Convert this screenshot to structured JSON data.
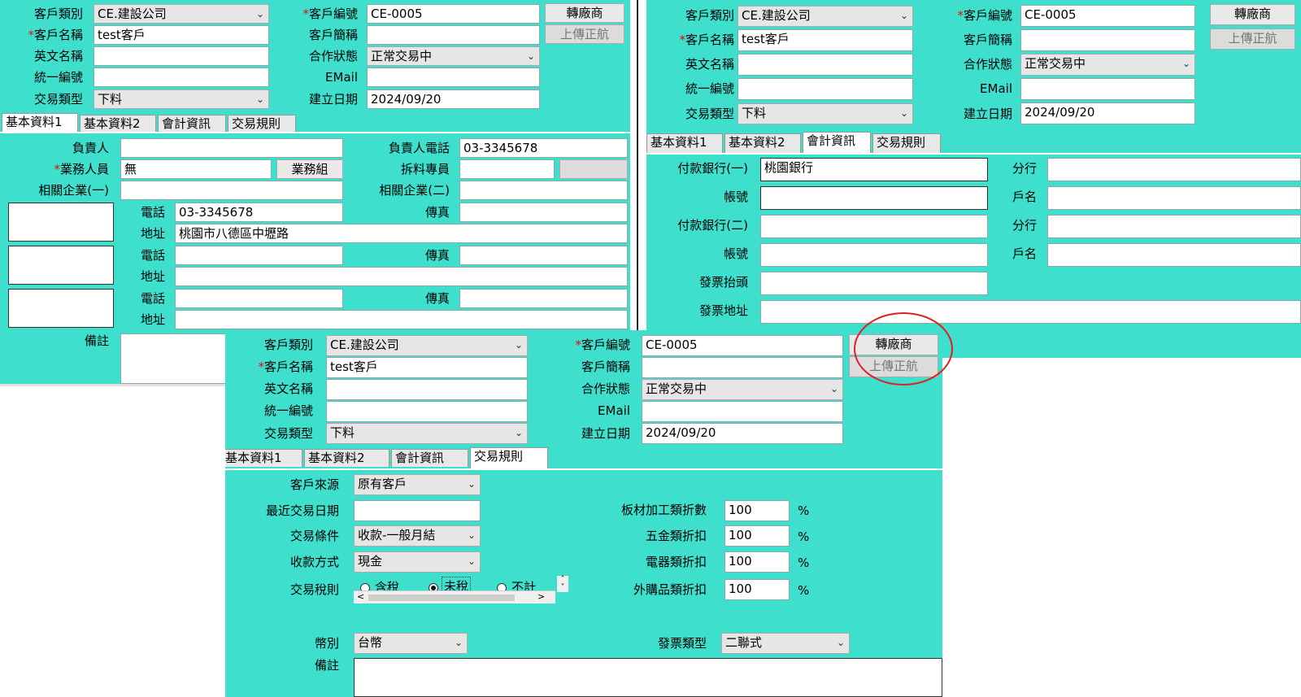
{
  "colors": {
    "panel": "#3fdfcd",
    "highlight": "#e02020"
  },
  "header": {
    "customer_type_label": "客戶類別",
    "customer_type_value": "CE.建設公司",
    "customer_no_label": "客戶編號",
    "customer_no_value": "CE-0005",
    "customer_name_label": "客戶名稱",
    "customer_name_value": "test客戶",
    "customer_short_label": "客戶簡稱",
    "english_name_label": "英文名稱",
    "cooperation_status_label": "合作狀態",
    "cooperation_status_value": "正常交易中",
    "tax_id_label": "統一編號",
    "email_label": "EMail",
    "trade_type_label": "交易類型",
    "trade_type_value": "下料",
    "created_date_label": "建立日期",
    "created_date_value": "2024/09/20",
    "transfer_vendor_button": "轉廠商",
    "upload_button": "上傳正航"
  },
  "tabs": [
    "基本資料1",
    "基本資料2",
    "會計資訊",
    "交易規則"
  ],
  "basic1": {
    "owner_label": "負責人",
    "owner_phone_label": "負責人電話",
    "owner_phone_value": "03-3345678",
    "salesperson_label": "業務人員",
    "salesperson_value": "無",
    "sales_group_button": "業務組",
    "scrap_staff_label": "拆料專員",
    "related1_label": "相關企業(一)",
    "related2_label": "相關企業(二)",
    "phone_label": "電話",
    "fax_label": "傳真",
    "address_label": "地址",
    "phone1_value": "03-3345678",
    "address1_value": "桃園市八德區中壢路",
    "remark_label": "備註"
  },
  "accounting": {
    "bank1_label": "付款銀行(一)",
    "bank1_value": "桃園銀行",
    "branch_label": "分行",
    "account_label": "帳號",
    "account_name_label": "戶名",
    "bank2_label": "付款銀行(二)",
    "invoice_title_label": "發票抬頭",
    "invoice_address_label": "發票地址"
  },
  "rules": {
    "source_label": "客戶來源",
    "source_value": "原有客戶",
    "last_trade_label": "最近交易日期",
    "trade_terms_label": "交易條件",
    "trade_terms_value": "收款-一般月結",
    "payment_label": "收款方式",
    "payment_value": "現金",
    "tax_rule_label": "交易稅則",
    "tax_options": [
      "含稅",
      "未稅",
      "不計"
    ],
    "board_discount_label": "板材加工類折數",
    "hardware_discount_label": "五金類折扣",
    "electric_discount_label": "電器類折扣",
    "outsourced_discount_label": "外購品類折扣",
    "discount_value": "100",
    "percent": "%",
    "currency_label": "幣別",
    "currency_value": "台幣",
    "invoice_type_label": "發票類型",
    "invoice_type_value": "二聯式",
    "remark_label": "備註"
  }
}
